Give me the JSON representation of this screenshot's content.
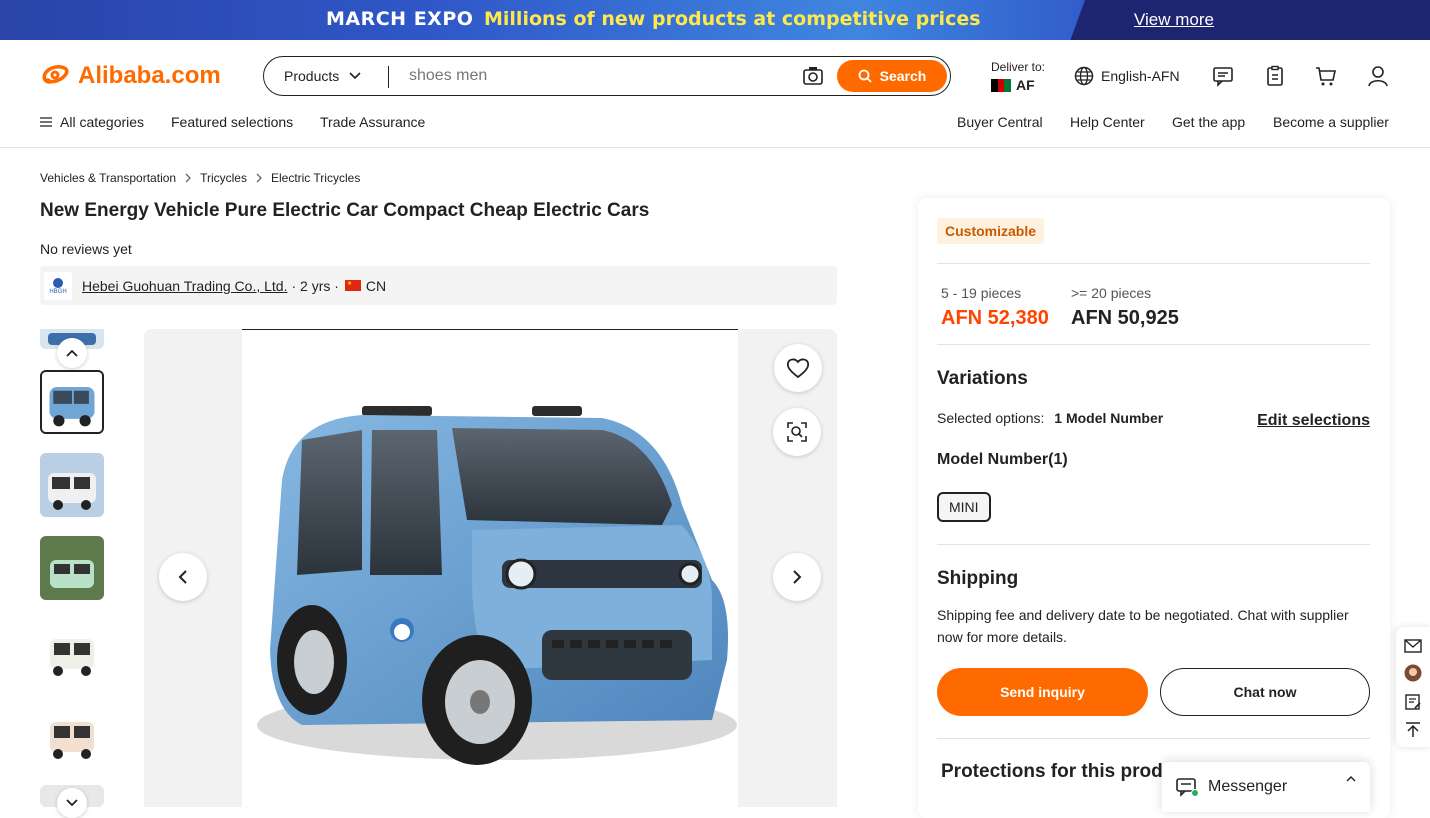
{
  "banner": {
    "brand": "MARCH EXPO",
    "tagline": "Millions of new products at competitive prices",
    "view_more": "View more"
  },
  "header": {
    "logo": "Alibaba.com",
    "search": {
      "category": "Products",
      "value": "shoes men",
      "button": "Search"
    },
    "deliver": {
      "label": "Deliver to:",
      "country": "AF"
    },
    "language": "English-AFN"
  },
  "nav": {
    "left": [
      "All categories",
      "Featured selections",
      "Trade Assurance"
    ],
    "right": [
      "Buyer Central",
      "Help Center",
      "Get the app",
      "Become a supplier"
    ]
  },
  "breadcrumb": [
    "Vehicles & Transportation",
    "Tricycles",
    "Electric Tricycles"
  ],
  "product": {
    "title": "New Energy Vehicle Pure Electric Car Compact Cheap Electric Cars",
    "reviews": "No reviews yet",
    "supplier_logo_text": "HBGH",
    "supplier_name": "Hebei Guohuan Trading Co., Ltd.",
    "supplier_years": "· 2 yrs ·",
    "supplier_country": "CN"
  },
  "panel": {
    "badge": "Customizable",
    "tiers": [
      {
        "qty": "5 - 19 pieces",
        "price": "AFN 52,380",
        "color": "#ff4400"
      },
      {
        "qty": ">= 20 pieces",
        "price": "AFN 50,925",
        "color": "#222222"
      }
    ],
    "variations_title": "Variations",
    "selected_label": "Selected options:",
    "selected_value": "1 Model Number",
    "edit_selections": "Edit selections",
    "model_label": "Model Number(1)",
    "model_option": "MINI",
    "shipping_title": "Shipping",
    "shipping_text": "Shipping fee and delivery date to be negotiated. Chat with supplier now for more details.",
    "send_inquiry": "Send inquiry",
    "chat_now": "Chat now",
    "protections_title": "Protections for this product"
  },
  "messenger": {
    "label": "Messenger"
  },
  "colors": {
    "accent": "#ff6a00",
    "price": "#ff4400",
    "car": "#6fa6d6"
  }
}
